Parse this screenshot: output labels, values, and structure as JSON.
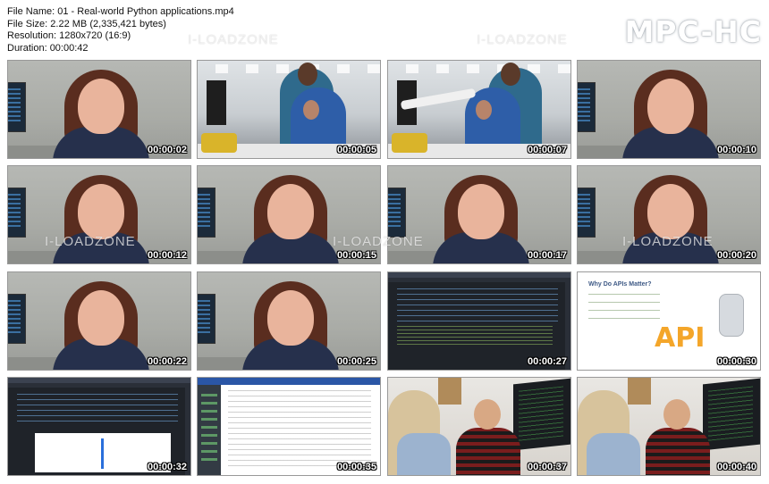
{
  "file_info": {
    "name_line": "File Name: 01 - Real-world Python applications.mp4",
    "size_line": "File Size: 2.22 MB (2,335,421 bytes)",
    "resolution_line": "Resolution: 1280x720 (16:9)",
    "duration_line": "Duration: 00:00:42"
  },
  "logo": "MPC-HC",
  "watermark": "I-LOADZONE",
  "thumbnails": [
    {
      "time": "00:00:02",
      "scene": "presenter"
    },
    {
      "time": "00:00:05",
      "scene": "office"
    },
    {
      "time": "00:00:07",
      "scene": "office-pointing"
    },
    {
      "time": "00:00:10",
      "scene": "presenter"
    },
    {
      "time": "00:00:12",
      "scene": "presenter"
    },
    {
      "time": "00:00:15",
      "scene": "presenter"
    },
    {
      "time": "00:00:17",
      "scene": "presenter"
    },
    {
      "time": "00:00:20",
      "scene": "presenter"
    },
    {
      "time": "00:00:22",
      "scene": "presenter"
    },
    {
      "time": "00:00:25",
      "scene": "presenter"
    },
    {
      "time": "00:00:27",
      "scene": "code-editor"
    },
    {
      "time": "00:00:30",
      "scene": "slide"
    },
    {
      "time": "00:00:32",
      "scene": "code-plot"
    },
    {
      "time": "00:00:35",
      "scene": "web-document"
    },
    {
      "time": "00:00:37",
      "scene": "meeting"
    },
    {
      "time": "00:00:40",
      "scene": "meeting"
    }
  ],
  "slide": {
    "title": "Why Do APIs Matter?",
    "graphic_text": "API"
  }
}
